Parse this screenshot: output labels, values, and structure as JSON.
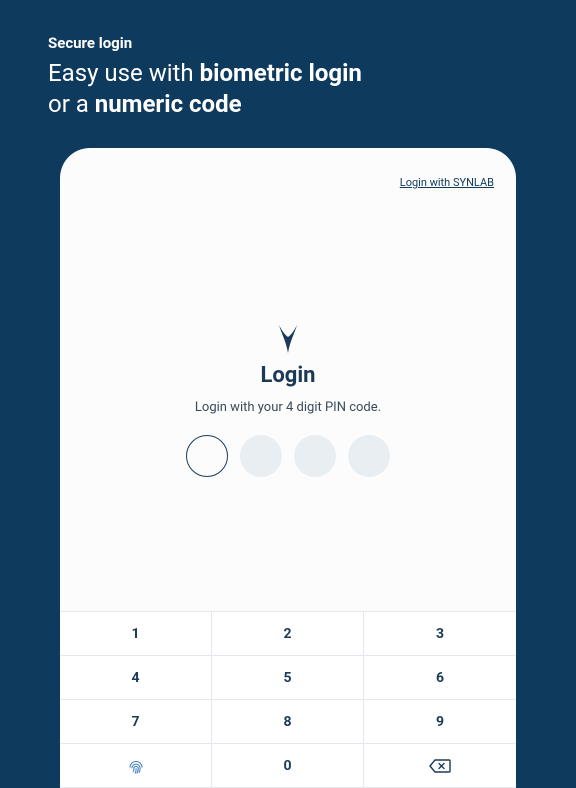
{
  "header": {
    "kicker": "Secure login",
    "headline_1": "Easy use with ",
    "headline_b1": "biometric login",
    "headline_2": " or a ",
    "headline_b2": "numeric code"
  },
  "login_link": "Login with SYNLAB",
  "title": "Login",
  "subtitle": "Login with your 4 digit PIN code.",
  "keypad": {
    "k1": "1",
    "k2": "2",
    "k3": "3",
    "k4": "4",
    "k5": "5",
    "k6": "6",
    "k7": "7",
    "k8": "8",
    "k9": "9",
    "k0": "0"
  },
  "colors": {
    "bg": "#0e3a5e",
    "text": "#1b3a58"
  }
}
